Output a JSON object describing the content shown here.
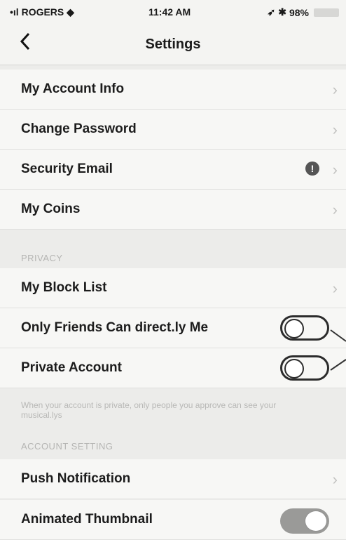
{
  "status_bar": {
    "carrier": "ROGERS",
    "time": "11:42 AM",
    "battery": "98%"
  },
  "nav": {
    "back_icon": "chevron-left-icon",
    "title": "Settings"
  },
  "rows_account": [
    {
      "label": "My Account Info"
    },
    {
      "label": "Change Password"
    },
    {
      "label": "Security Email",
      "badge": "!"
    },
    {
      "label": "My Coins"
    }
  ],
  "privacy": {
    "header": "PRIVACY",
    "block_list": "My Block List",
    "only_friends": "Only Friends Can direct.ly Me",
    "private_account": "Private Account",
    "note": "When your account is private, only people you approve can see your musical.lys"
  },
  "account_setting": {
    "header": "ACCOUNT SETTING",
    "push": "Push Notification",
    "animated": "Animated Thumbnail"
  },
  "toggles": {
    "only_friends": "off",
    "private_account": "off",
    "animated_thumbnail": "on"
  },
  "chevron_glyph": "›"
}
